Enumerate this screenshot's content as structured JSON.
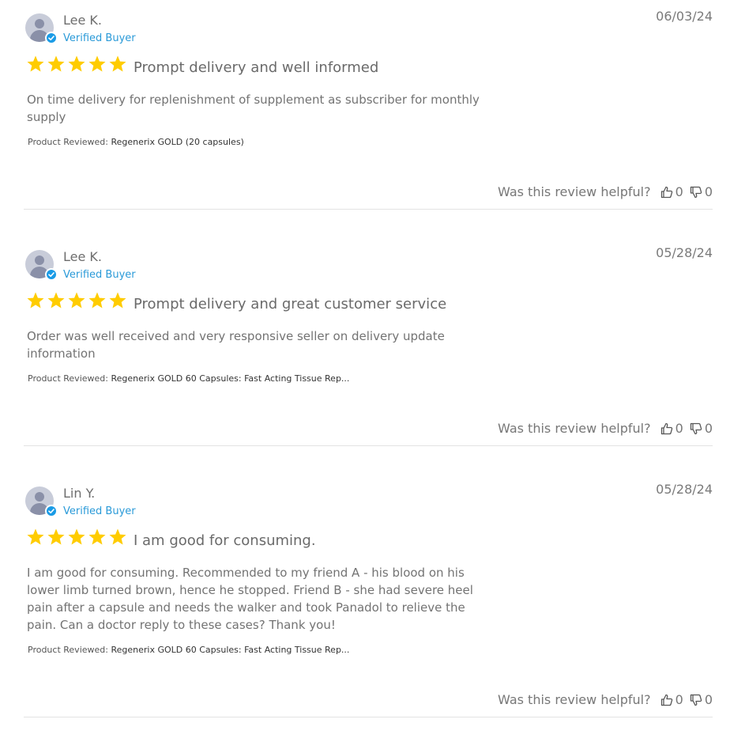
{
  "reviews": [
    {
      "name": "Lee K.",
      "badge": "Verified Buyer",
      "date": "06/03/24",
      "rating": 5,
      "headline": "Prompt delivery and well informed",
      "body": "On time delivery for replenishment of supplement as subscriber for monthly supply",
      "product_label": "Product Reviewed:",
      "product_name": "Regenerix GOLD (20 capsules)",
      "helpful_question": "Was this review helpful?",
      "thumbs_up": "0",
      "thumbs_down": "0"
    },
    {
      "name": "Lee K.",
      "badge": "Verified Buyer",
      "date": "05/28/24",
      "rating": 5,
      "headline": "Prompt delivery and great customer service",
      "body": "Order was well received and very responsive seller on delivery update information",
      "product_label": "Product Reviewed:",
      "product_name": "Regenerix GOLD 60 Capsules: Fast Acting Tissue Rep...",
      "helpful_question": "Was this review helpful?",
      "thumbs_up": "0",
      "thumbs_down": "0"
    },
    {
      "name": "Lin Y.",
      "badge": "Verified Buyer",
      "date": "05/28/24",
      "rating": 5,
      "headline": "I am good for consuming.",
      "body": "I am good for consuming. Recommended to my friend A - his blood on his lower limb turned brown, hence he stopped. Friend B - she had severe heel pain after a capsule and needs the walker and took Panadol to relieve the pain. Can a doctor reply to these cases? Thank you!",
      "product_label": "Product Reviewed:",
      "product_name": "Regenerix GOLD 60 Capsules: Fast Acting Tissue Rep...",
      "helpful_question": "Was this review helpful?",
      "thumbs_up": "0",
      "thumbs_down": "0"
    }
  ],
  "colors": {
    "star": "#ffcc00",
    "verified": "#2a9ad8",
    "divider": "#e3e3e3"
  },
  "icons": {
    "avatar": "user-avatar-icon",
    "verified": "verified-check-icon",
    "star": "star-icon",
    "thumbs_up": "thumbs-up-icon",
    "thumbs_down": "thumbs-down-icon"
  }
}
